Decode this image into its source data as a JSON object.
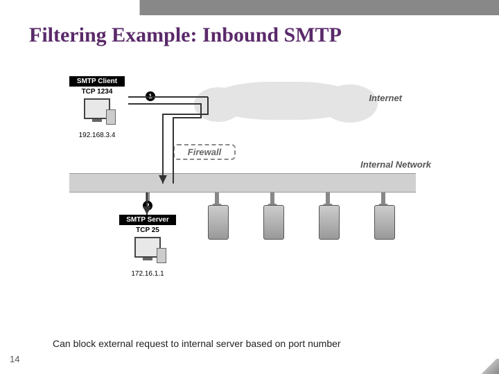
{
  "slide": {
    "title": "Filtering Example: Inbound SMTP",
    "caption": "Can block external request to internal server based on port number",
    "page_number": "14"
  },
  "client": {
    "box_label": "SMTP Client",
    "port": "TCP 1234",
    "ip": "192.168.3.4"
  },
  "server": {
    "box_label": "SMTP Server",
    "port": "TCP 25",
    "ip": "172.16.1.1"
  },
  "labels": {
    "internet": "Internet",
    "firewall": "Firewall",
    "internal_network": "Internal Network"
  },
  "markers": {
    "one": "1",
    "two": "2"
  }
}
